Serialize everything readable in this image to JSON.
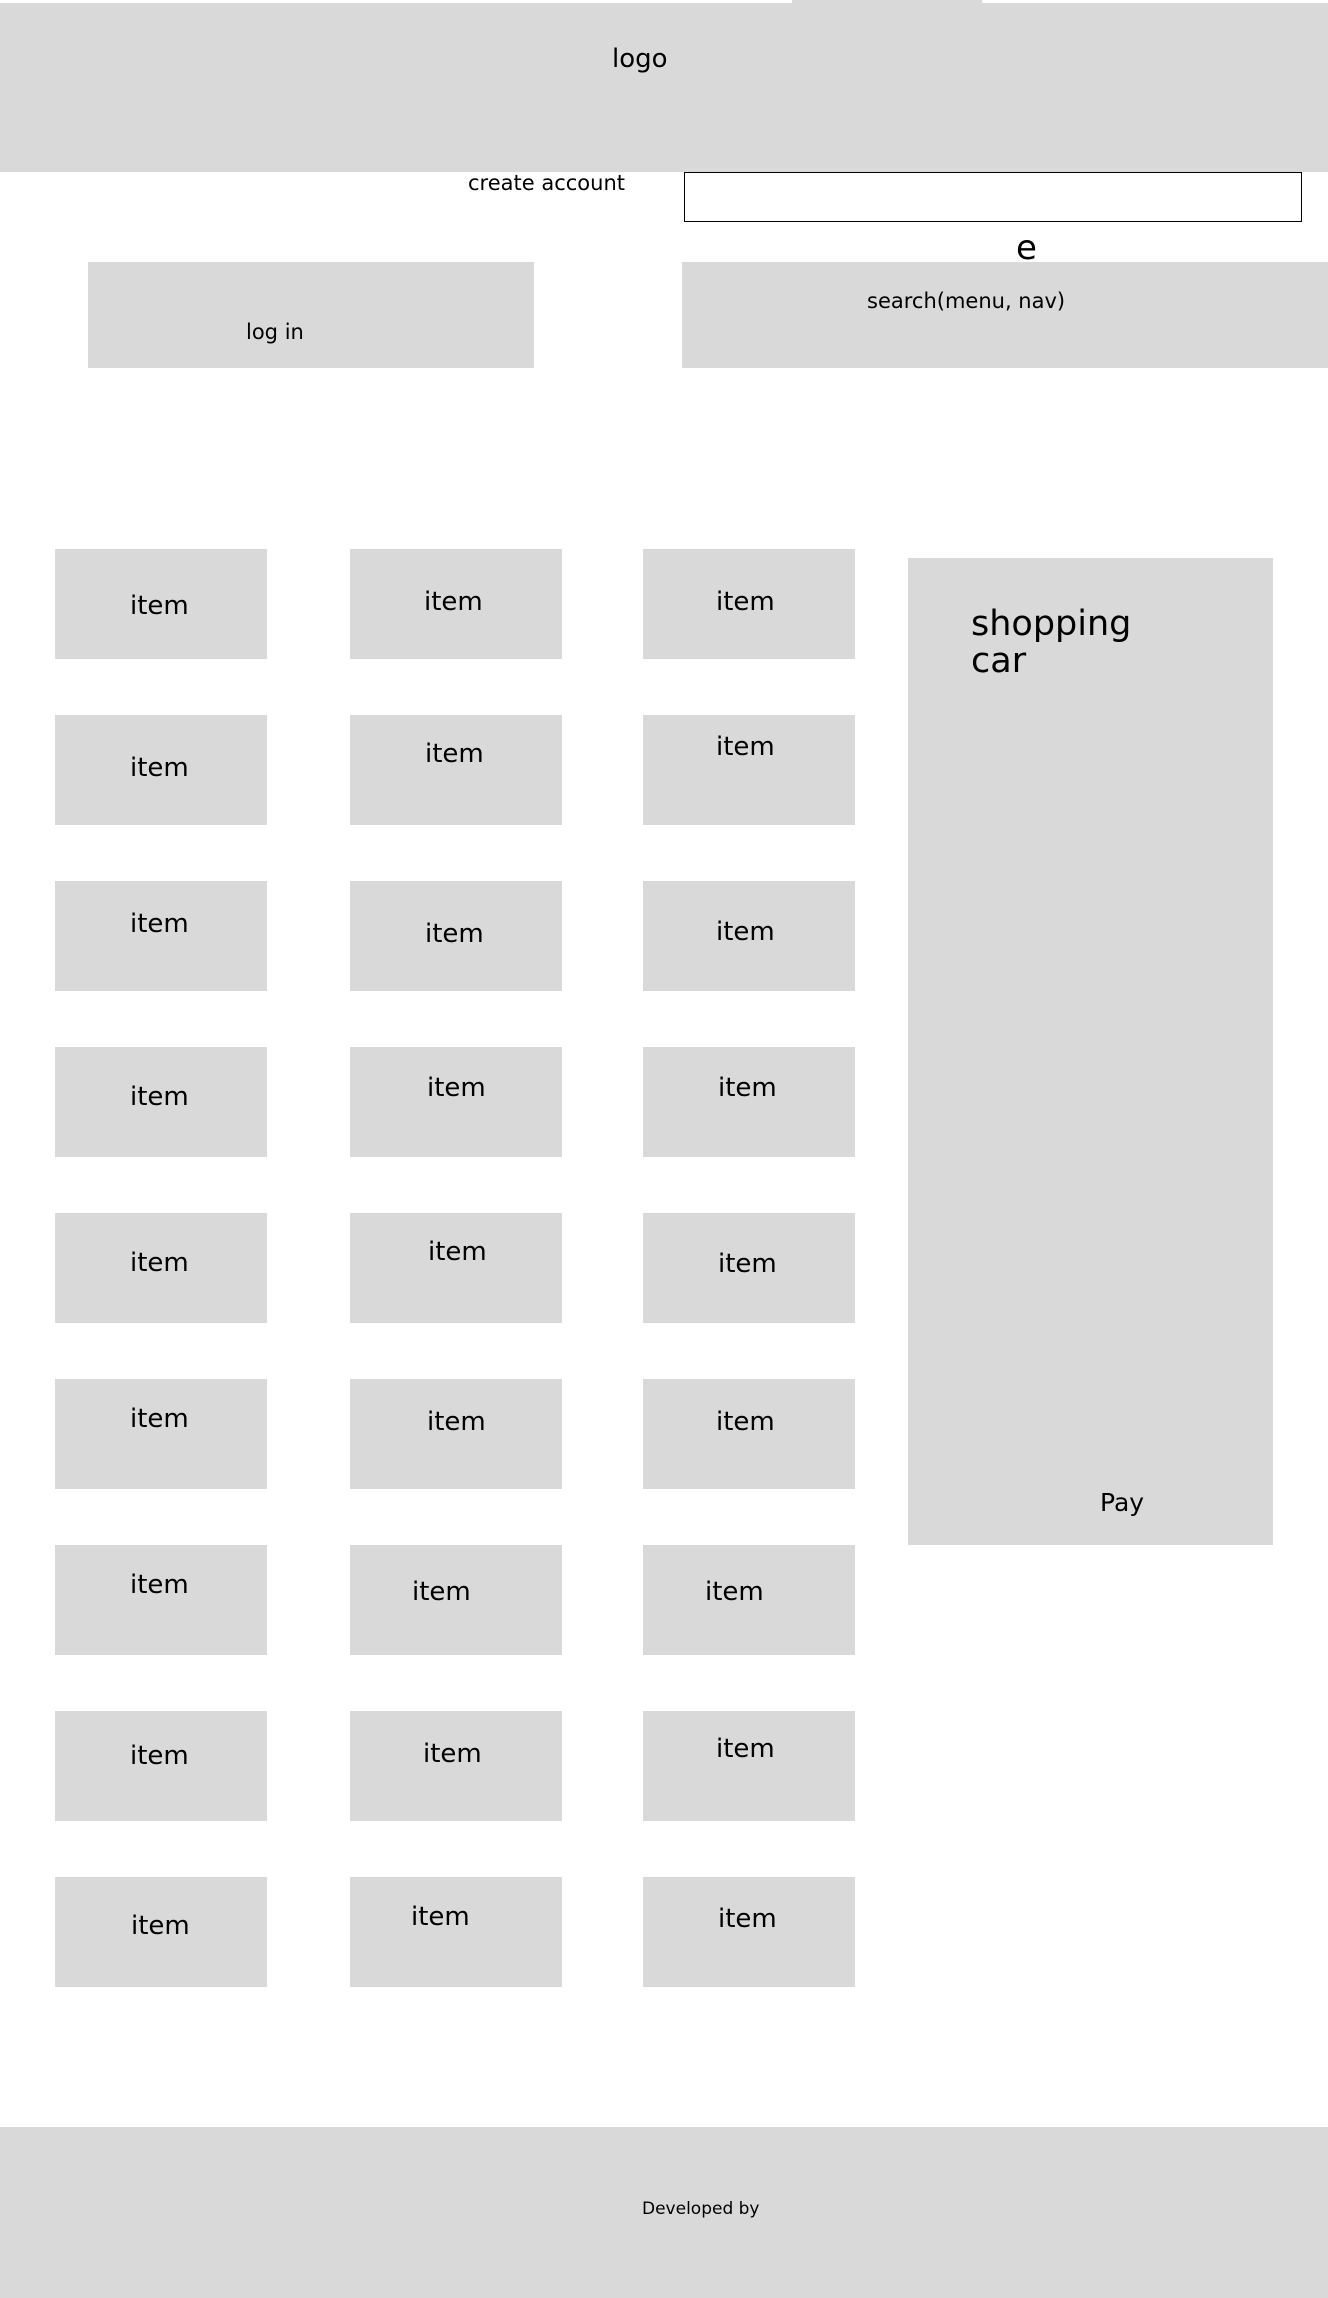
{
  "header": {
    "logo_text": "logo",
    "create_account": "create account",
    "search_placeholder": "",
    "stray_char": "e",
    "login_label": "log in",
    "search_nav_label": "search(menu, nav)"
  },
  "items": [
    "item",
    "item",
    "item",
    "item",
    "item",
    "item",
    "item",
    "item",
    "item",
    "item",
    "item",
    "item",
    "item",
    "item",
    "item",
    "item",
    "item",
    "item",
    "item",
    "item",
    "item",
    "item",
    "item",
    "item",
    "item",
    "item",
    "item"
  ],
  "cart": {
    "title": "shopping car",
    "pay_label": "Pay"
  },
  "footer": {
    "developed_by": "Developed by"
  },
  "colors": {
    "placeholder_fill": "#d9d9d9",
    "background": "#ffffff",
    "text": "#000000"
  }
}
